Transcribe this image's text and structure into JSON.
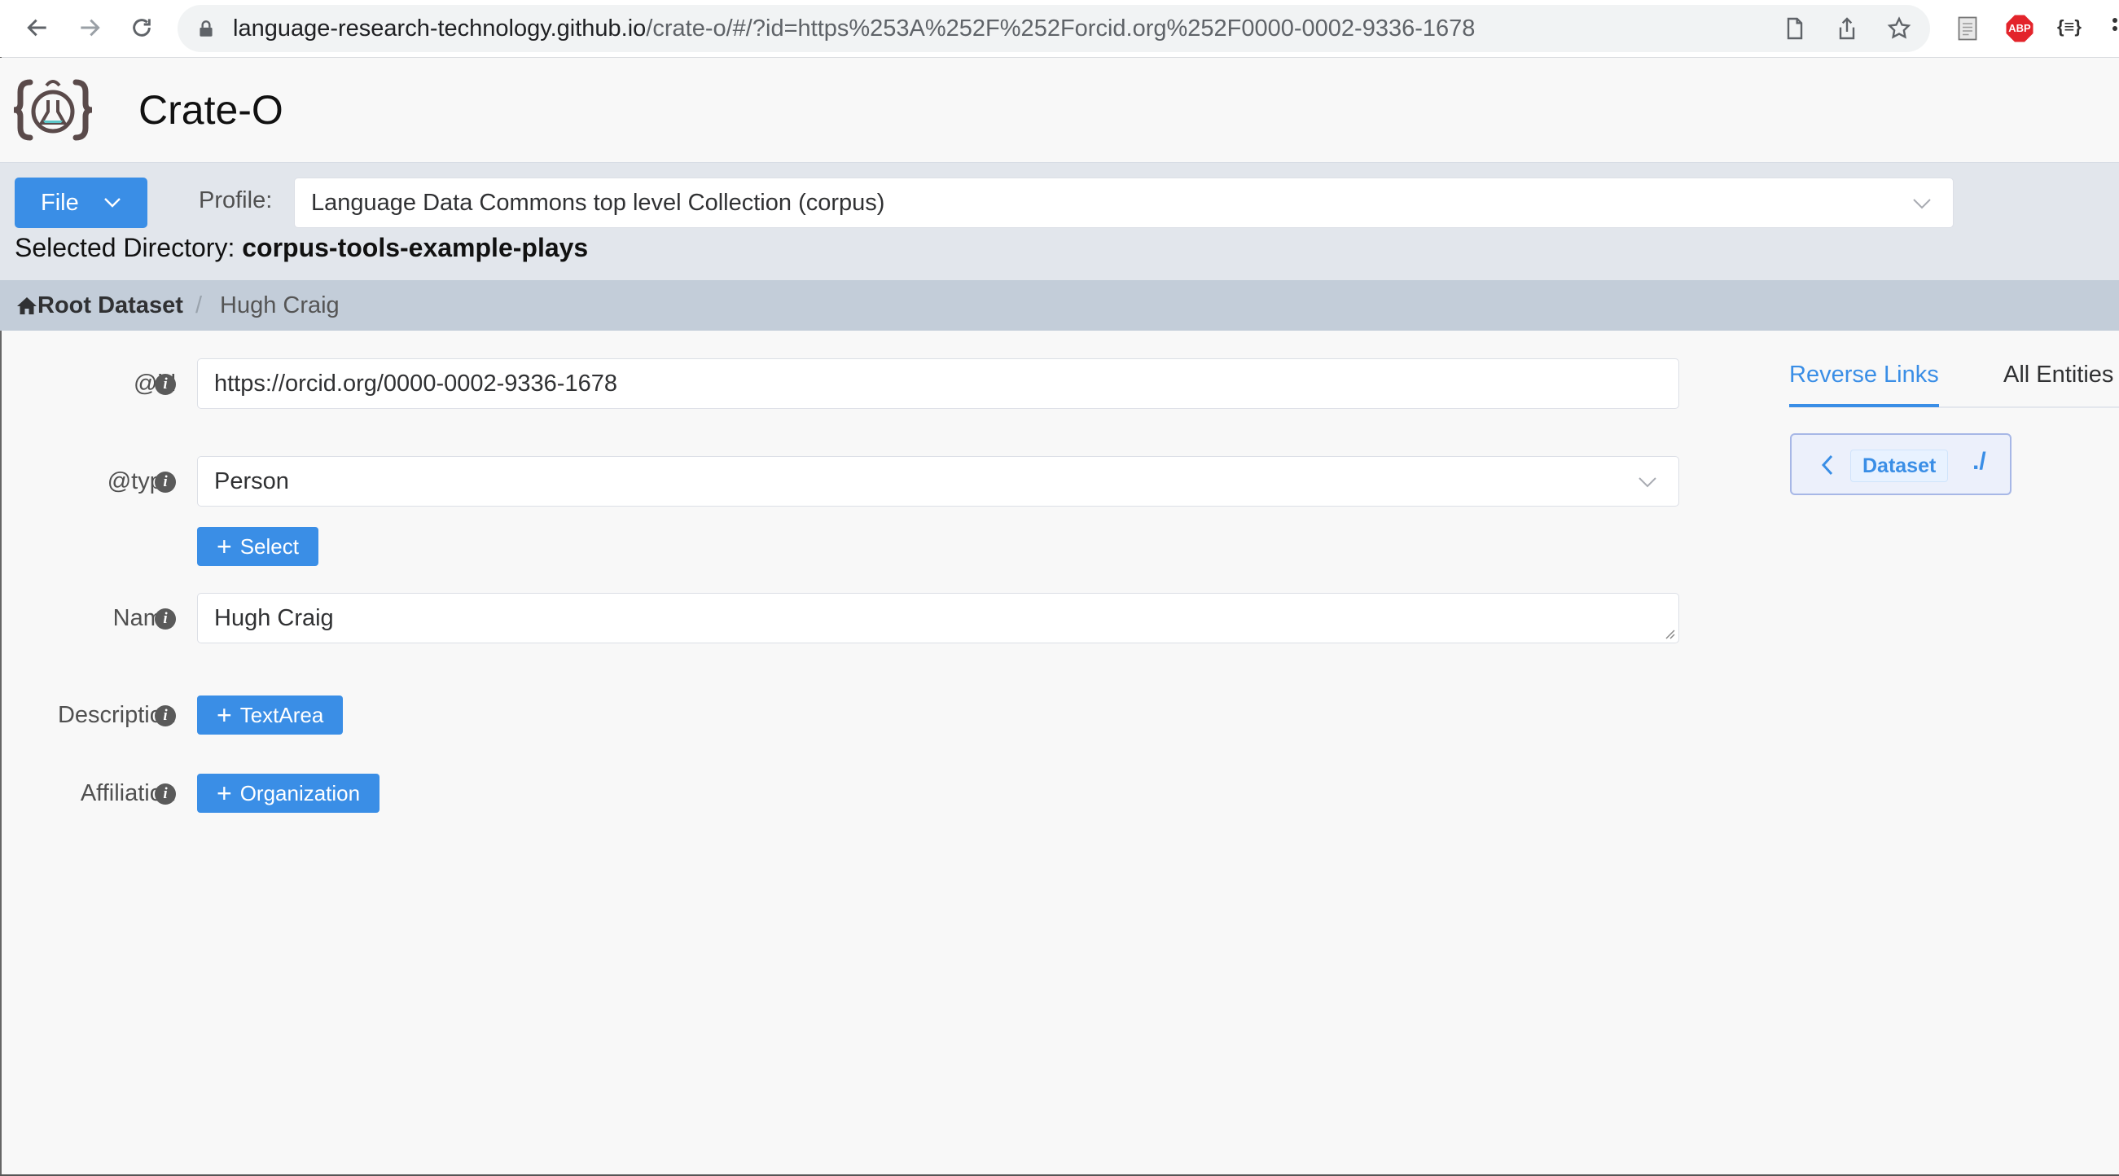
{
  "browser": {
    "url_host": "language-research-technology.github.io",
    "url_path": "/crate-o/#/?id=https%253A%252F%252Forcid.org%252F0000-0002-9336-1678",
    "extensions": [
      "ABP",
      "{≡}"
    ]
  },
  "app": {
    "title": "Crate-O"
  },
  "toolbar": {
    "file_label": "File",
    "profile_label": "Profile:",
    "profile_value": "Language Data Commons top level Collection (corpus)",
    "selected_dir_label": "Selected Directory:",
    "selected_dir_value": "corpus-tools-example-plays"
  },
  "breadcrumb": {
    "root": "Root Dataset",
    "separator": "/",
    "current": "Hugh Craig"
  },
  "form": {
    "id": {
      "label": "@id",
      "value": "https://orcid.org/0000-0002-9336-1678"
    },
    "type": {
      "label": "@type",
      "value": "Person",
      "add_label": "Select"
    },
    "name": {
      "label": "Name",
      "value": "Hugh Craig"
    },
    "description": {
      "label": "Description",
      "add_label": "TextArea"
    },
    "affiliation": {
      "label": "Affiliation",
      "add_label": "Organization"
    },
    "info_glyph": "i",
    "plus_glyph": "+"
  },
  "side_panel": {
    "tabs": [
      "Reverse Links",
      "All Entities"
    ],
    "active_tab": "Reverse Links",
    "reverse_links": [
      {
        "type": "Dataset",
        "id": "./"
      }
    ]
  },
  "colors": {
    "primary": "#3a8ee6",
    "toolbar_bg": "#e2e6ec",
    "breadcrumb_bg": "#c3cdd9"
  }
}
